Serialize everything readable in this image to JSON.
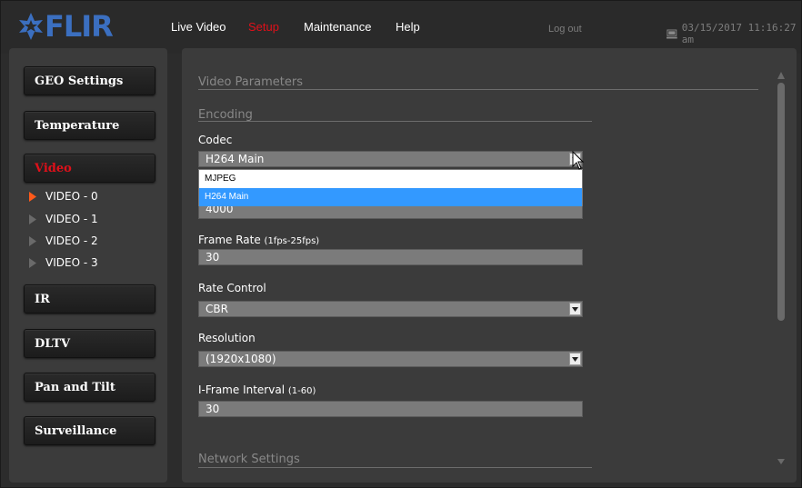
{
  "brand": {
    "name": "FLIR",
    "color": "#3b6fc0"
  },
  "topnav": {
    "items": [
      "Live Video",
      "Setup",
      "Maintenance",
      "Help"
    ],
    "active": "Setup",
    "logout": "Log out",
    "datetime": "03/15/2017 11:16:27 am"
  },
  "sidebar": {
    "buttons": [
      "GEO Settings",
      "Temperature",
      "Video",
      "IR",
      "DLTV",
      "Pan and Tilt",
      "Surveillance"
    ],
    "active": "Video",
    "video_items": [
      "VIDEO - 0",
      "VIDEO - 1",
      "VIDEO - 2",
      "VIDEO - 3"
    ],
    "active_video_item": "VIDEO - 0"
  },
  "main": {
    "section_title": "Video Parameters",
    "encoding_title": "Encoding",
    "codec": {
      "label": "Codec",
      "value": "H264 Main",
      "options": [
        "MJPEG",
        "H264 Main"
      ],
      "highlighted": "H264 Main"
    },
    "bitrate_value": "4000",
    "frame_rate": {
      "label": "Frame Rate",
      "hint": "(1fps-25fps)",
      "value": "30"
    },
    "rate_control": {
      "label": "Rate Control",
      "value": "CBR"
    },
    "resolution": {
      "label": "Resolution",
      "value": "(1920x1080)"
    },
    "iframe_interval": {
      "label": "I-Frame Interval",
      "hint": "(1-60)",
      "value": "30"
    },
    "network_title": "Network Settings"
  },
  "colors": {
    "active_red": "#e0101a",
    "highlight_blue": "#3399ff",
    "panel_bg": "#3b3b3b",
    "field_bg": "#7b7b7b"
  }
}
